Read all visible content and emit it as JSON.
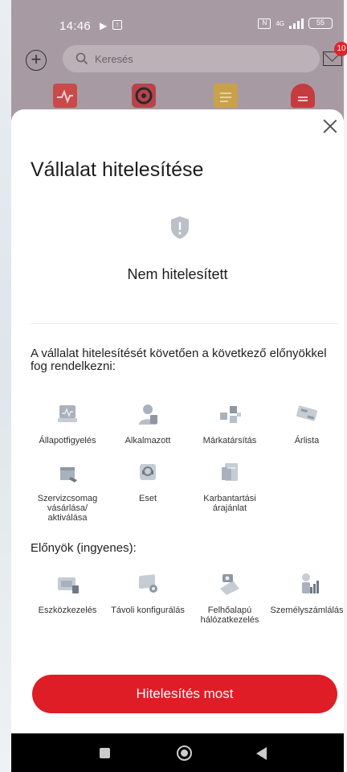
{
  "status_bar": {
    "time": "14:46",
    "network": "4G",
    "battery": "55"
  },
  "header": {
    "search_placeholder": "Keresés",
    "mail_badge": "10"
  },
  "sheet": {
    "title": "Vállalat hitelesítése",
    "status_text": "Nem hitelesített",
    "intro": "A vállalat hitelesítését követően a következő előnyökkel fog rendelkezni:",
    "features": [
      {
        "label": "Állapotfigyelés",
        "icon": "monitoring-icon"
      },
      {
        "label": "Alkalmazott",
        "icon": "employee-icon"
      },
      {
        "label": "Márkatársítás",
        "icon": "brand-association-icon"
      },
      {
        "label": "Árlista",
        "icon": "price-list-icon"
      },
      {
        "label": "Szervizcsomag vásárlása/ aktiválása",
        "icon": "service-package-icon"
      },
      {
        "label": "Eset",
        "icon": "case-icon"
      },
      {
        "label": "Karbantartási árajánlat",
        "icon": "maintenance-quote-icon"
      }
    ],
    "free_heading": "Előnyök (ingyenes):",
    "free_features": [
      {
        "label": "Eszközkezelés",
        "icon": "device-management-icon"
      },
      {
        "label": "Távoli konfigurálás",
        "icon": "remote-config-icon"
      },
      {
        "label": "Felhőalapú hálózatkezelés",
        "icon": "cloud-network-icon"
      },
      {
        "label": "Személyszámlálás",
        "icon": "people-counting-icon"
      }
    ],
    "cta_label": "Hitelesítés most"
  },
  "colors": {
    "accent": "#df1d26",
    "icon_gray": "#9aa3ad"
  }
}
